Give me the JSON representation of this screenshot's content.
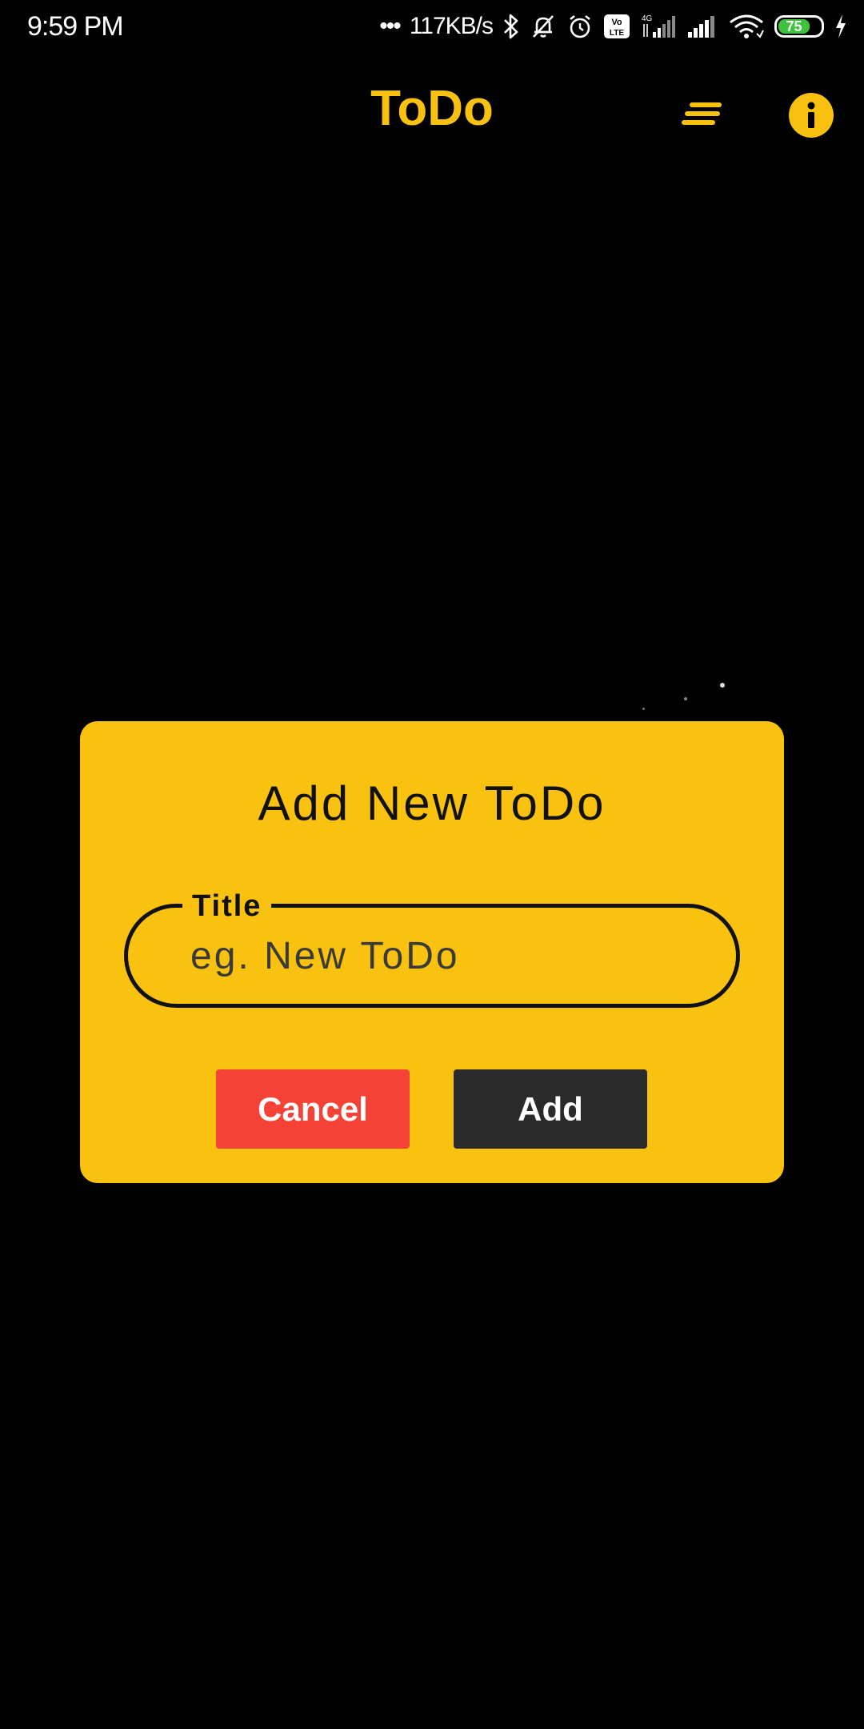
{
  "status_bar": {
    "time": "9:59 PM",
    "dots": "•••",
    "network_speed": "117KB/s",
    "battery_level": "75",
    "battery_color": "#3cc23c",
    "icons": [
      "bluetooth-icon",
      "muted-bell-icon",
      "alarm-icon",
      "volte-icon",
      "signal-4g-icon",
      "signal-icon",
      "wifi-icon",
      "battery-icon",
      "charging-icon"
    ]
  },
  "app_bar": {
    "title": "ToDo",
    "menu_icon": "sort-lines-icon",
    "info_icon": "info-icon"
  },
  "dialog": {
    "title": "Add New ToDo",
    "field_label": "Title",
    "field_placeholder": "eg. New ToDo",
    "field_value": "",
    "cancel_label": "Cancel",
    "add_label": "Add"
  },
  "colors": {
    "background": "#000000",
    "accent": "#f9c10f",
    "dialog_background": "#f9c211",
    "cancel_button": "#f44336",
    "add_button": "#2a2a2a"
  }
}
